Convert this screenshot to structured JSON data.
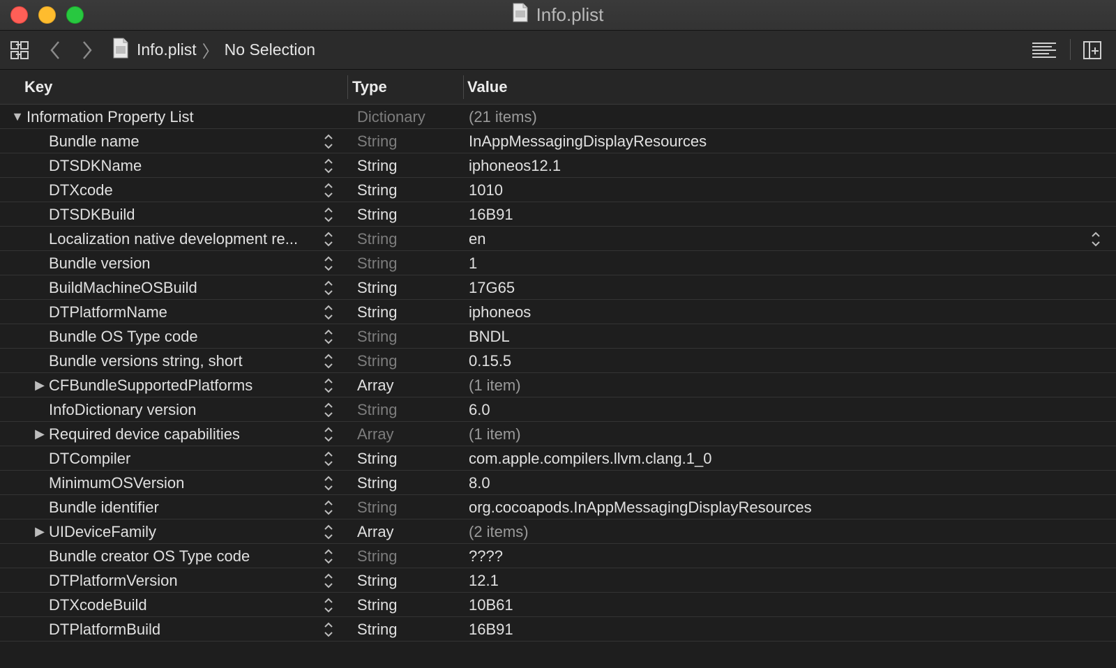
{
  "window": {
    "title": "Info.plist"
  },
  "toolbar": {
    "icons": [
      "related-items-icon",
      "back-icon",
      "forward-icon",
      "plist-file-icon",
      "editor-options-icon",
      "add-editor-icon"
    ],
    "crumbs": [
      "Info.plist",
      "No Selection"
    ]
  },
  "columns": {
    "key": "Key",
    "type": "Type",
    "value": "Value"
  },
  "root": {
    "key": "Information Property List",
    "type": "Dictionary",
    "value": "(21 items)"
  },
  "rows": [
    {
      "key": "Bundle name",
      "type": "String",
      "value": "InAppMessagingDisplayResources",
      "type_dim": true,
      "value_dim": false,
      "expandable": false
    },
    {
      "key": "DTSDKName",
      "type": "String",
      "value": "iphoneos12.1",
      "type_dim": false,
      "value_dim": false,
      "expandable": false
    },
    {
      "key": "DTXcode",
      "type": "String",
      "value": "1010",
      "type_dim": false,
      "value_dim": false,
      "expandable": false
    },
    {
      "key": "DTSDKBuild",
      "type": "String",
      "value": "16B91",
      "type_dim": false,
      "value_dim": false,
      "expandable": false
    },
    {
      "key": "Localization native development re...",
      "type": "String",
      "value": "en",
      "type_dim": true,
      "value_dim": false,
      "expandable": false,
      "value_popup": true
    },
    {
      "key": "Bundle version",
      "type": "String",
      "value": "1",
      "type_dim": true,
      "value_dim": false,
      "expandable": false
    },
    {
      "key": "BuildMachineOSBuild",
      "type": "String",
      "value": "17G65",
      "type_dim": false,
      "value_dim": false,
      "expandable": false
    },
    {
      "key": "DTPlatformName",
      "type": "String",
      "value": "iphoneos",
      "type_dim": false,
      "value_dim": false,
      "expandable": false
    },
    {
      "key": "Bundle OS Type code",
      "type": "String",
      "value": "BNDL",
      "type_dim": true,
      "value_dim": false,
      "expandable": false
    },
    {
      "key": "Bundle versions string, short",
      "type": "String",
      "value": "0.15.5",
      "type_dim": true,
      "value_dim": false,
      "expandable": false
    },
    {
      "key": "CFBundleSupportedPlatforms",
      "type": "Array",
      "value": "(1 item)",
      "type_dim": false,
      "value_dim": true,
      "expandable": true
    },
    {
      "key": "InfoDictionary version",
      "type": "String",
      "value": "6.0",
      "type_dim": true,
      "value_dim": false,
      "expandable": false
    },
    {
      "key": "Required device capabilities",
      "type": "Array",
      "value": "(1 item)",
      "type_dim": true,
      "value_dim": true,
      "expandable": true
    },
    {
      "key": "DTCompiler",
      "type": "String",
      "value": "com.apple.compilers.llvm.clang.1_0",
      "type_dim": false,
      "value_dim": false,
      "expandable": false
    },
    {
      "key": "MinimumOSVersion",
      "type": "String",
      "value": "8.0",
      "type_dim": false,
      "value_dim": false,
      "expandable": false
    },
    {
      "key": "Bundle identifier",
      "type": "String",
      "value": "org.cocoapods.InAppMessagingDisplayResources",
      "type_dim": true,
      "value_dim": false,
      "expandable": false
    },
    {
      "key": "UIDeviceFamily",
      "type": "Array",
      "value": "(2 items)",
      "type_dim": false,
      "value_dim": true,
      "expandable": true
    },
    {
      "key": "Bundle creator OS Type code",
      "type": "String",
      "value": "????",
      "type_dim": true,
      "value_dim": false,
      "expandable": false
    },
    {
      "key": "DTPlatformVersion",
      "type": "String",
      "value": "12.1",
      "type_dim": false,
      "value_dim": false,
      "expandable": false
    },
    {
      "key": "DTXcodeBuild",
      "type": "String",
      "value": "10B61",
      "type_dim": false,
      "value_dim": false,
      "expandable": false
    },
    {
      "key": "DTPlatformBuild",
      "type": "String",
      "value": "16B91",
      "type_dim": false,
      "value_dim": false,
      "expandable": false
    }
  ],
  "colors": {
    "close": "#ff5f57",
    "minimize": "#febc2e",
    "zoom": "#28c840",
    "text": "#e0e0e0",
    "dim_text": "#7d7d7d",
    "background": "#1e1e1e"
  }
}
